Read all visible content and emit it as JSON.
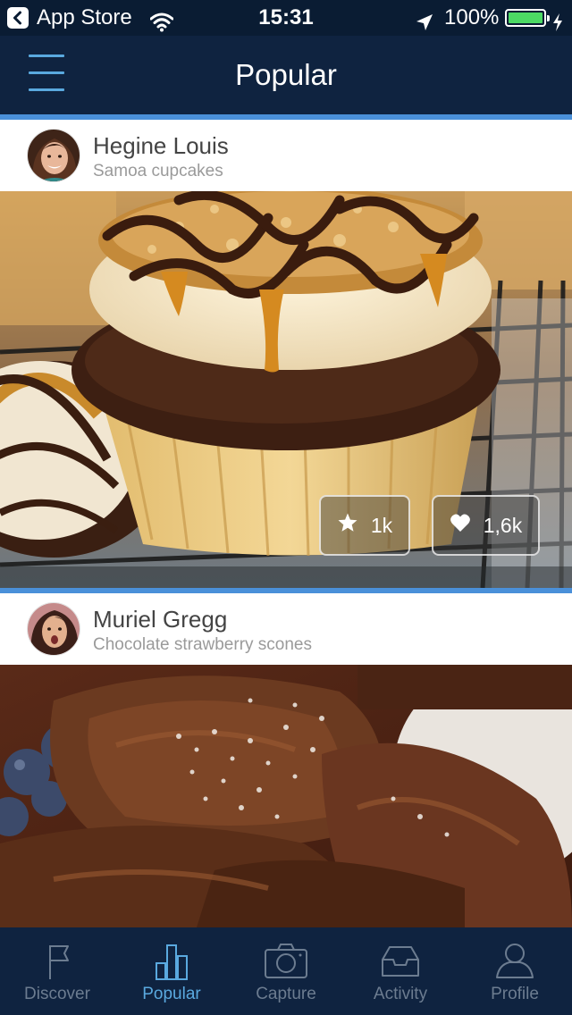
{
  "status_bar": {
    "back_app": "App Store",
    "time": "15:31",
    "battery": "100%",
    "battery_level": 1.0,
    "battery_color": "#4cd964"
  },
  "nav": {
    "title": "Popular",
    "menu_icon": "hamburger-icon",
    "accent_color": "#4a90d9"
  },
  "feed": [
    {
      "author": "Hegine Louis",
      "title": "Samoa cupcakes",
      "favorites": "1k",
      "likes": "1,6k",
      "favorite_icon": "star-icon",
      "like_icon": "heart-icon"
    },
    {
      "author": "Muriel Gregg",
      "title": "Chocolate strawberry scones"
    }
  ],
  "tabbar": {
    "active": "Popular",
    "items": [
      {
        "label": "Discover",
        "icon": "flag-icon"
      },
      {
        "label": "Popular",
        "icon": "bar-chart-icon"
      },
      {
        "label": "Capture",
        "icon": "camera-icon"
      },
      {
        "label": "Activity",
        "icon": "inbox-icon"
      },
      {
        "label": "Profile",
        "icon": "user-icon"
      }
    ],
    "active_color": "#5aa9df",
    "inactive_color": "#6c7c90"
  }
}
